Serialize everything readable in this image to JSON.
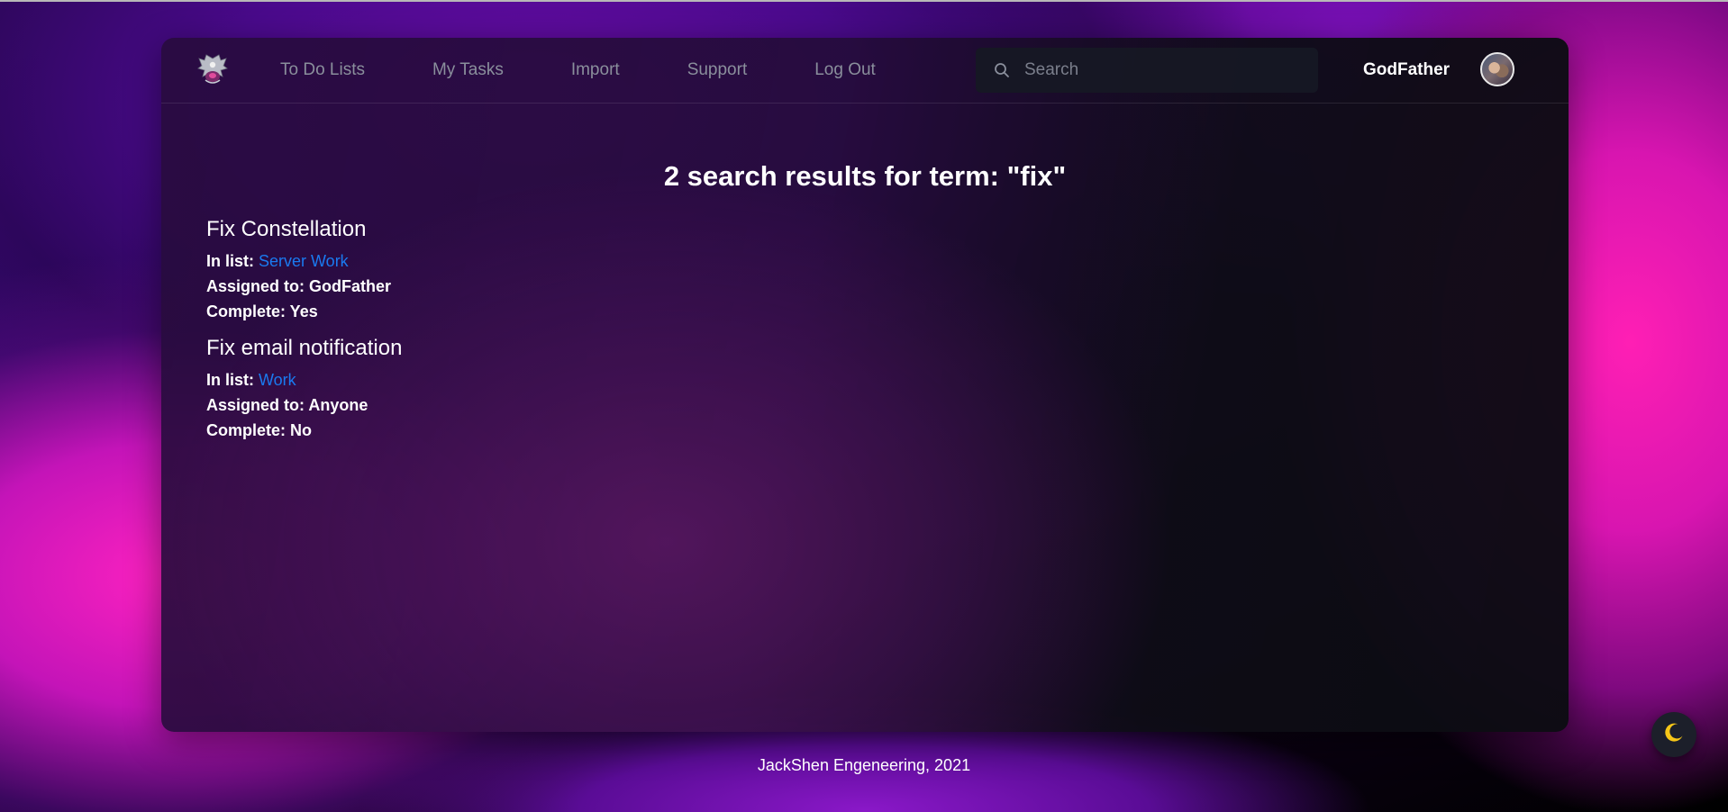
{
  "nav": {
    "logo_icon": "eagle-crest-logo",
    "links": [
      {
        "label": "To Do Lists"
      },
      {
        "label": "My Tasks"
      },
      {
        "label": "Import"
      },
      {
        "label": "Support"
      },
      {
        "label": "Log Out"
      }
    ],
    "search": {
      "placeholder": "Search",
      "value": "",
      "icon": "search-icon"
    },
    "username": "GodFather",
    "avatar_icon": "user-avatar"
  },
  "main": {
    "heading": "2 search results for term: \"fix\"",
    "results": [
      {
        "title": "Fix Constellation",
        "list_prefix": "In list: ",
        "list_name": "Server Work",
        "assigned": "Assigned to: GodFather",
        "complete": "Complete: Yes"
      },
      {
        "title": "Fix email notification",
        "list_prefix": "In list: ",
        "list_name": "Work",
        "assigned": "Assigned to: Anyone",
        "complete": "Complete: No"
      }
    ]
  },
  "footer": {
    "text": "JackShen Engeneering, 2021"
  },
  "theme_toggle": {
    "icon": "moon-icon",
    "icon_color": "#f5c518"
  },
  "colors": {
    "link": "#1a7af0",
    "nav_text": "#8a8f9c",
    "text": "#ffffff"
  }
}
